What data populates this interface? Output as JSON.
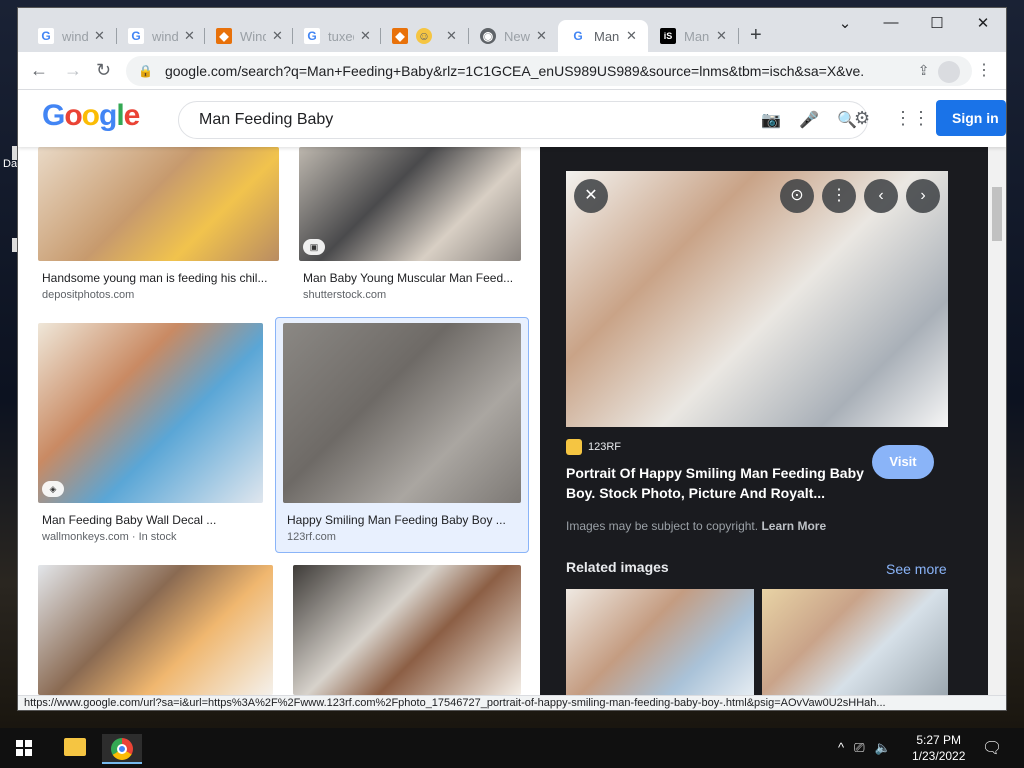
{
  "desktop": {
    "label": "Da"
  },
  "browser": {
    "tabs": [
      {
        "title": "windows",
        "favicon": "g-icon"
      },
      {
        "title": "windows",
        "favicon": "g-icon"
      },
      {
        "title": "Windows",
        "favicon": "orange-shield-icon"
      },
      {
        "title": "tuxedo",
        "favicon": "g-icon"
      },
      {
        "title": "",
        "favicon": "emoji-icon"
      },
      {
        "title": "New Tab",
        "favicon": "chrome-icon"
      },
      {
        "title": "Man",
        "favicon": "g-icon"
      },
      {
        "title": "Man",
        "favicon": "istock-icon"
      }
    ],
    "url": "google.com/search?q=Man+Feeding+Baby&rlz=1C1GCEA_enUS989US989&source=lnms&tbm=isch&sa=X&ve..."
  },
  "google": {
    "logo": "Google",
    "query": "Man Feeding Baby",
    "signin": "Sign in"
  },
  "results": [
    {
      "title": "Handsome young man is feeding his chil...",
      "source": "depositphotos.com"
    },
    {
      "title": "Man Baby Young Muscular Man Feed...",
      "source": "shutterstock.com"
    },
    {
      "title": "Man Feeding Baby Wall Decal ...",
      "source": "wallmonkeys.com · In stock"
    },
    {
      "title": "Happy Smiling Man Feeding Baby Boy ...",
      "source": "123rf.com"
    }
  ],
  "panel": {
    "source_name": "123RF",
    "title": "Portrait Of Happy Smiling Man Feeding Baby Boy. Stock Photo, Picture And Royalt...",
    "visit": "Visit",
    "copyright": "Images may be subject to copyright.",
    "learn_more": "Learn More",
    "related": "Related images",
    "see_more": "See more"
  },
  "status_url": "https://www.google.com/url?sa=i&url=https%3A%2F%2Fwww.123rf.com%2Fphoto_17546727_portrait-of-happy-smiling-man-feeding-baby-boy-.html&psig=AOvVaw0U2sHHah...",
  "taskbar": {
    "time": "5:27 PM",
    "date": "1/23/2022"
  },
  "colors": {
    "accent": "#1a73e8",
    "panel_bg": "#1a1b1f",
    "link_dark": "#8ab4f8"
  }
}
